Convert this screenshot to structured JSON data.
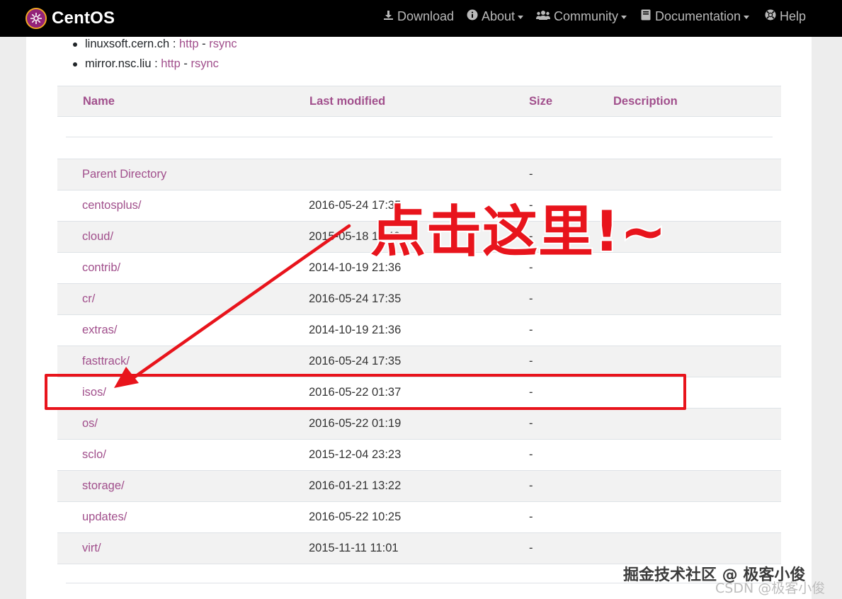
{
  "navbar": {
    "brand": "CentOS",
    "items": [
      {
        "label": "Download",
        "icon": "download-icon",
        "dropdown": false
      },
      {
        "label": "About",
        "icon": "info-circle-icon",
        "dropdown": true
      },
      {
        "label": "Community",
        "icon": "users-icon",
        "dropdown": true
      },
      {
        "label": "Documentation",
        "icon": "book-icon",
        "dropdown": true
      },
      {
        "label": "Help",
        "icon": "life-ring-icon",
        "dropdown": false
      }
    ]
  },
  "mirrors": [
    {
      "host": "linuxsoft.cern.ch",
      "sep": " : ",
      "http": "http",
      "dash": " - ",
      "rsync": "rsync"
    },
    {
      "host": "mirror.nsc.liu",
      "sep": " : ",
      "http": "http",
      "dash": " - ",
      "rsync": "rsync"
    }
  ],
  "table": {
    "headers": {
      "name": "Name",
      "modified": "Last modified",
      "size": "Size",
      "description": "Description"
    },
    "rows": [
      {
        "name": "Parent Directory",
        "modified": "",
        "size": "-"
      },
      {
        "name": "centosplus/",
        "modified": "2016-05-24 17:35",
        "size": "-"
      },
      {
        "name": "cloud/",
        "modified": "2015-05-18 11:40",
        "size": "-"
      },
      {
        "name": "contrib/",
        "modified": "2014-10-19 21:36",
        "size": "-"
      },
      {
        "name": "cr/",
        "modified": "2016-05-24 17:35",
        "size": "-"
      },
      {
        "name": "extras/",
        "modified": "2014-10-19 21:36",
        "size": "-"
      },
      {
        "name": "fasttrack/",
        "modified": "2016-05-24 17:35",
        "size": "-"
      },
      {
        "name": "isos/",
        "modified": "2016-05-22 01:37",
        "size": "-"
      },
      {
        "name": "os/",
        "modified": "2016-05-22 01:19",
        "size": "-"
      },
      {
        "name": "sclo/",
        "modified": "2015-12-04 23:23",
        "size": "-"
      },
      {
        "name": "storage/",
        "modified": "2016-01-21 13:22",
        "size": "-"
      },
      {
        "name": "updates/",
        "modified": "2016-05-22 10:25",
        "size": "-"
      },
      {
        "name": "virt/",
        "modified": "2015-11-11 11:01",
        "size": "-"
      }
    ]
  },
  "annotation": {
    "callout": "点击这里!~",
    "color": "#e8141c"
  },
  "watermarks": {
    "line1": "掘金技术社区 @ 极客小俊",
    "line2": "CSDN @极客小俊"
  },
  "colors": {
    "link": "#a14f8c",
    "navbar_bg": "#000000",
    "brand": "#932279"
  }
}
